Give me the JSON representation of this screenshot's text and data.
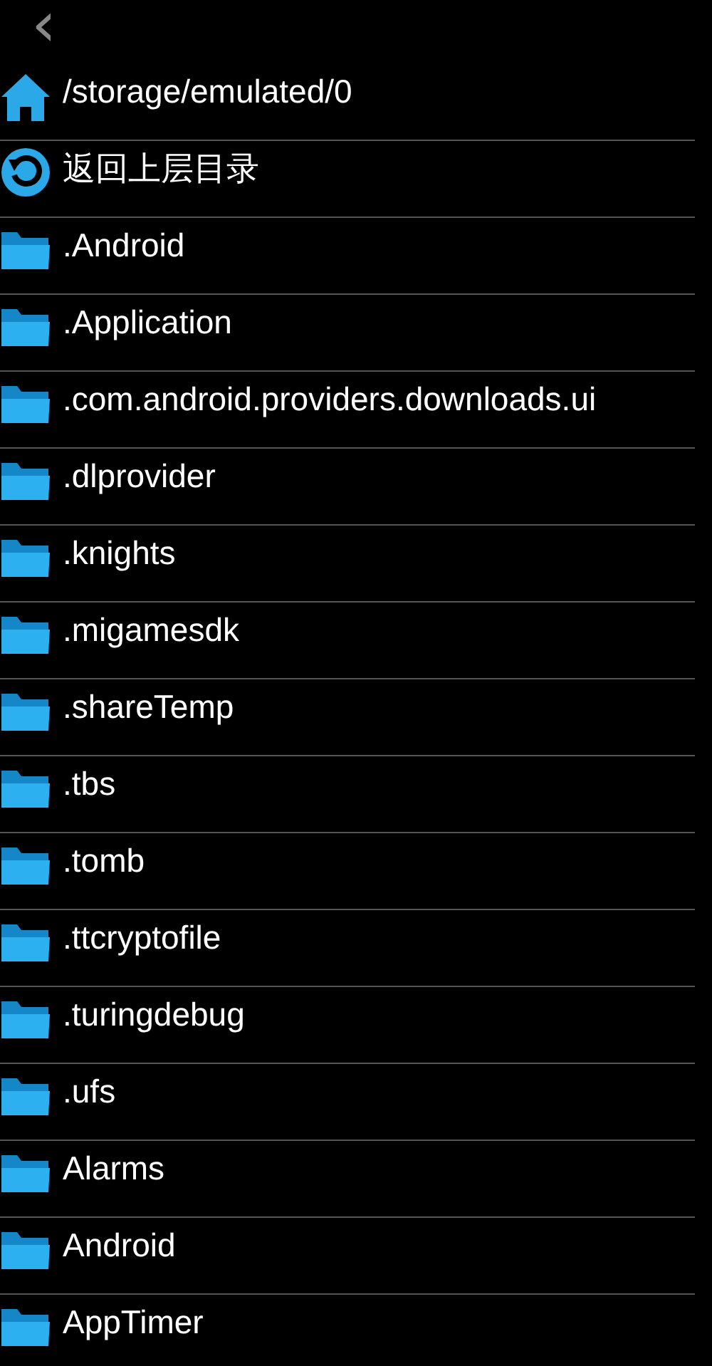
{
  "toolbar": {
    "back": "‹"
  },
  "entries": [
    {
      "kind": "path",
      "label": "/storage/emulated/0"
    },
    {
      "kind": "up",
      "label": "返回上层目录"
    },
    {
      "kind": "folder",
      "label": ".Android"
    },
    {
      "kind": "folder",
      "label": ".Application"
    },
    {
      "kind": "folder",
      "label": ".com.android.providers.downloads.ui"
    },
    {
      "kind": "folder",
      "label": ".dlprovider"
    },
    {
      "kind": "folder",
      "label": ".knights"
    },
    {
      "kind": "folder",
      "label": ".migamesdk"
    },
    {
      "kind": "folder",
      "label": ".shareTemp"
    },
    {
      "kind": "folder",
      "label": ".tbs"
    },
    {
      "kind": "folder",
      "label": ".tomb"
    },
    {
      "kind": "folder",
      "label": ".ttcryptofile"
    },
    {
      "kind": "folder",
      "label": ".turingdebug"
    },
    {
      "kind": "folder",
      "label": ".ufs"
    },
    {
      "kind": "folder",
      "label": "Alarms"
    },
    {
      "kind": "folder",
      "label": "Android"
    },
    {
      "kind": "folder",
      "label": "AppTimer"
    }
  ]
}
